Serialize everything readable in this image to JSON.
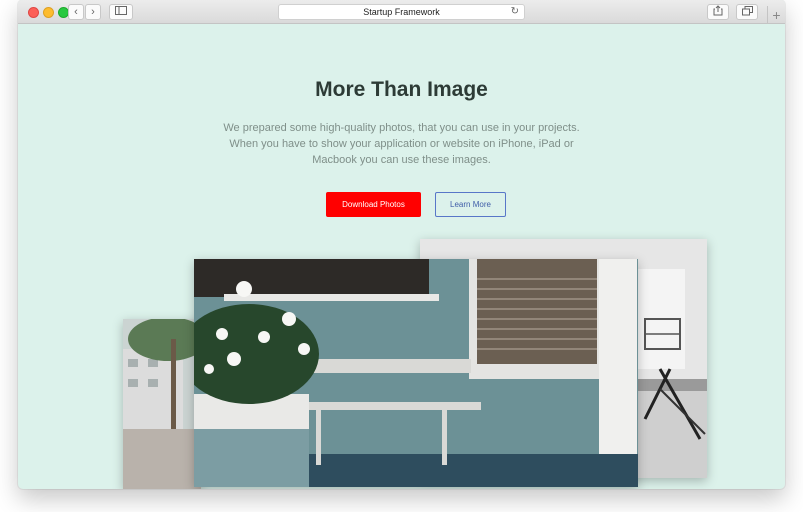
{
  "browser": {
    "address_text": "Startup Framework",
    "icons": [
      "back-icon",
      "forward-icon",
      "sidebar-icon",
      "reload-icon",
      "share-icon",
      "tabs-icon",
      "new-tab-icon"
    ]
  },
  "hero": {
    "title": "More Than Image",
    "description_lines": [
      "We prepared some high-quality photos, that you can use in your projects.",
      "When you have to show your application or website on iPhone, iPad or",
      "Macbook you can use these images."
    ],
    "primary_button": "Download Photos",
    "secondary_button": "Learn More"
  },
  "colors": {
    "background": "#dcf2eb",
    "primary_button": "#ff0000",
    "secondary_button_border": "#5877c8",
    "title": "#2d3b36"
  }
}
